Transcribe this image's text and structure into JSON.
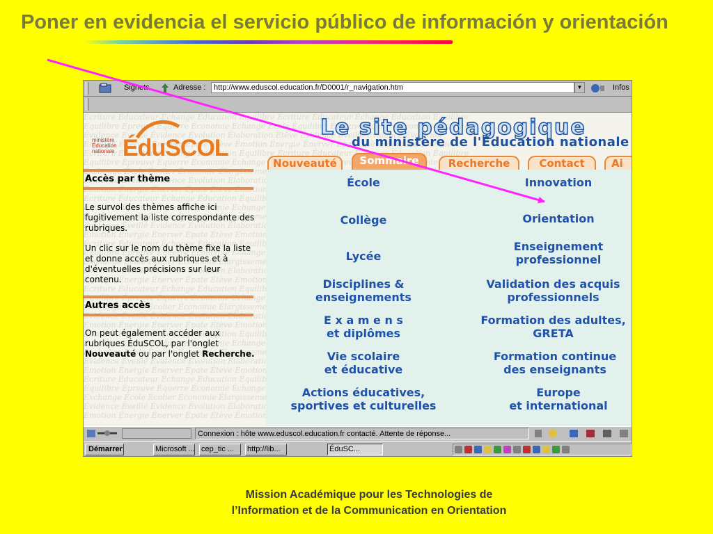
{
  "slide": {
    "title": "Poner en evidencia el servicio público de información y orientación",
    "footer": "Mission Académique pour les Technologies de l’Information et de la Communication en Orientation"
  },
  "browser": {
    "toolbar": {
      "bookmarks_label": "Signets",
      "address_label": "Adresse :",
      "url": "http://www.eduscol.education.fr/D0001/r_navigation.htm",
      "info_label": "Infos"
    },
    "status_text": "Connexion : hôte www.eduscol.education.fr contacté. Attente de réponse...",
    "taskbar": {
      "start_label": "Démarrer",
      "tasks": [
        "Microsoft ...",
        "cep_tic ...",
        "http://lib...",
        "ÉduSC..."
      ]
    }
  },
  "site": {
    "logo_small": "ministère Éducation nationale",
    "logo_text": "ÉduSCOL",
    "title": "Le site pédagogique",
    "subtitle": "du ministère de l'Éducation nationale",
    "tabs": [
      "Nouveauté",
      "Sommaire",
      "Recherche",
      "Contact",
      "Ai"
    ],
    "sidebar": {
      "heading1": "Accès par thème",
      "para1": "Le survol des thèmes affiche ici fugitivement la liste correspondante des rubriques.",
      "para2": "Un clic sur le nom du thème fixe la liste et donne accès aux rubriques et à d'éventuelles précisions sur leur contenu.",
      "heading2": "Autres accès",
      "para3_pre": "On peut également accéder aux rubriques ÉduSCOL, par l'onglet",
      "para3_b1": "Nouveauté",
      "para3_mid": "ou par l'onglet",
      "para3_b2": "Recherche."
    },
    "links": [
      {
        "line1": "École",
        "line2": ""
      },
      {
        "line1": "Innovation",
        "line2": ""
      },
      {
        "line1": "Collège",
        "line2": ""
      },
      {
        "line1": "Orientation",
        "line2": ""
      },
      {
        "line1": "Lycée",
        "line2": ""
      },
      {
        "line1": "Enseignement",
        "line2": "professionnel"
      },
      {
        "line1": "Disciplines &",
        "line2": "enseignements"
      },
      {
        "line1": "Validation des acquis",
        "line2": "professionnels"
      },
      {
        "line1": "E x a m e n s",
        "line2": "et diplômes"
      },
      {
        "line1": "Formation des adultes,",
        "line2": "GRETA"
      },
      {
        "line1": "Vie scolaire",
        "line2": "et éducative"
      },
      {
        "line1": "Formation continue",
        "line2": "des enseignants"
      },
      {
        "line1": "Actions éducatives,",
        "line2": "sportives et culturelles"
      },
      {
        "line1": "Europe",
        "line2": "et international"
      }
    ]
  },
  "colors": {
    "slide_background": "#ffff00",
    "arrow": "#ff22ff",
    "link_blue": "#1f52a8",
    "tab_orange": "#e88a3a"
  }
}
